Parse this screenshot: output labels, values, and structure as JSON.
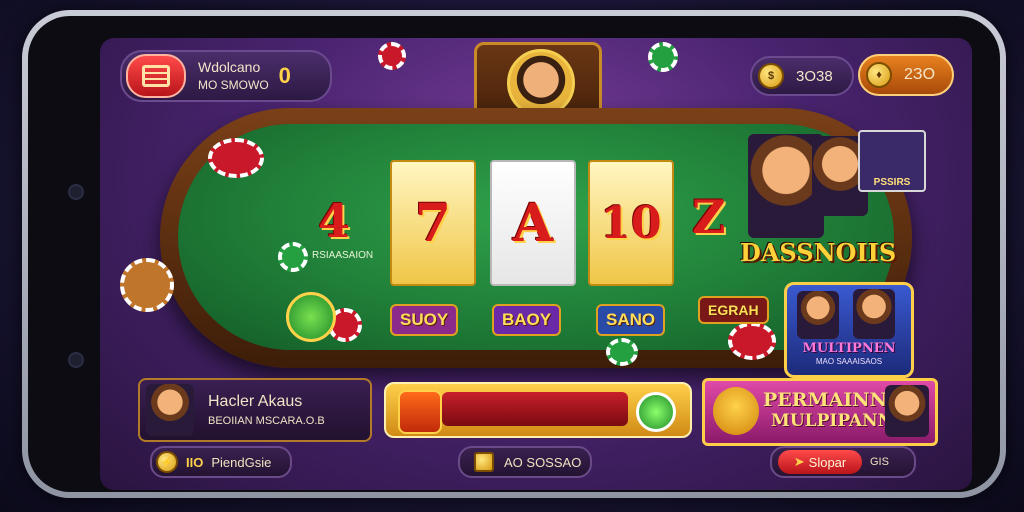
{
  "top_left": {
    "title": "Wdolcano",
    "subtitle": "MO SMOWO",
    "value": "0"
  },
  "top_right": {
    "coins_a": "3O38",
    "coins_b": "2ЗO"
  },
  "reels": {
    "side_left": "4",
    "r1": "7",
    "r2": "A",
    "r3": "10",
    "side_right": "Z"
  },
  "table_labels": {
    "left_small": "RSIAASAION",
    "btn1": "SUOY",
    "btn2": "BAOY",
    "btn3": "SANO",
    "btn4": "EGRAH"
  },
  "promo_top": {
    "title": "DASSNOIIS",
    "card_label": "PSSIRS"
  },
  "promo_mid": {
    "line1": "MULTIPNEN",
    "line2": "MAO SAAAISAOS"
  },
  "player_panel": {
    "name": "Hacler Akaus",
    "detail": "BEOIIAN MSCARA.O.B"
  },
  "bonus_panel": {
    "line1": "PERMAINN",
    "line2": "MULPIPANN"
  },
  "bottom": {
    "left_label": "IIO",
    "left_value": "PiendGsie",
    "center_label": "AO SOSSAO",
    "right_button": "Slopar",
    "right_suffix": "GIS"
  }
}
